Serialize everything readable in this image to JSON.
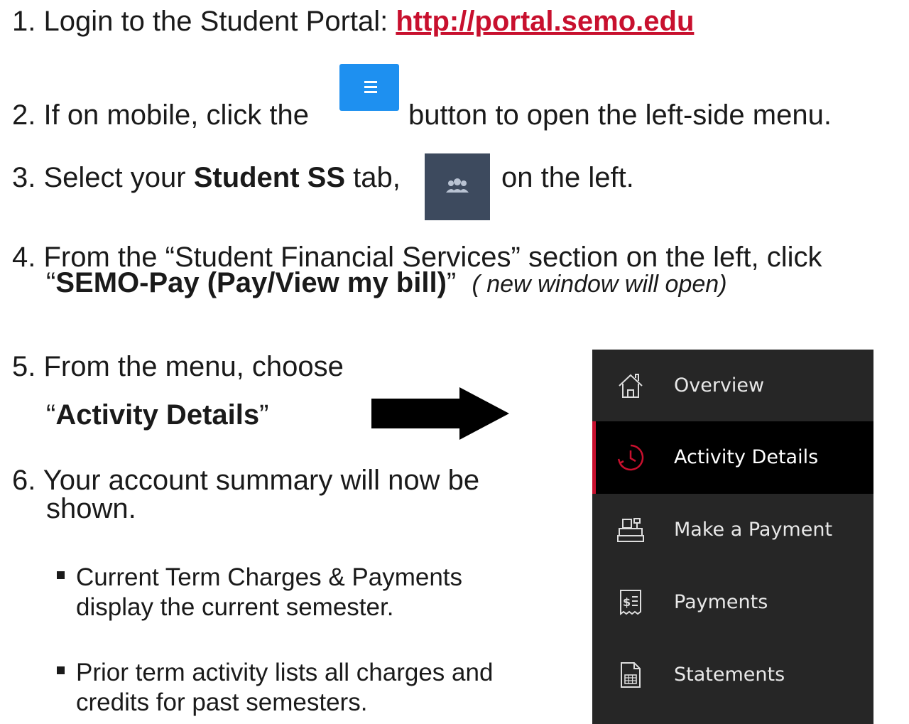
{
  "steps": {
    "s1": {
      "prefix": "1. Login to the Student Portal:  ",
      "link": "http://portal.semo.edu"
    },
    "s2": {
      "before": "2. If on mobile, click the ",
      "after": " button to open the left-side menu."
    },
    "s3": {
      "before": "3. Select your ",
      "bold": "Student SS",
      "mid": " tab, ",
      "after": " on the left."
    },
    "s4": {
      "line1": "4. From the “Student Financial Services” section on the left, click",
      "q_open": "“",
      "bold": "SEMO-Pay (Pay/View my bill)",
      "q_close": "”",
      "note": "( new window will open)"
    },
    "s5": {
      "line1": "5. From the menu, choose",
      "q_open": "“",
      "bold": "Activity Details",
      "q_close": "”"
    },
    "s6": {
      "line1": "6. Your account summary will now be",
      "line2": "shown.",
      "bullets": [
        {
          "line1": "Current Term Charges & Payments",
          "line2": "display the current semester."
        },
        {
          "line1": "Prior term activity lists all charges and",
          "line2": "credits for past semesters."
        }
      ]
    }
  },
  "sidebar": {
    "items": [
      {
        "label": "Overview",
        "icon": "home-icon"
      },
      {
        "label": "Activity Details",
        "icon": "clock-icon",
        "active": true
      },
      {
        "label": "Make a Payment",
        "icon": "cash-register-icon"
      },
      {
        "label": "Payments",
        "icon": "receipt-icon"
      },
      {
        "label": "Statements",
        "icon": "statement-icon"
      }
    ]
  },
  "colors": {
    "link": "#c8102e",
    "menu_button": "#1e90f0",
    "tab_icon_bg": "#3d4a5e",
    "sidebar_bg": "#262626",
    "active_accent": "#c8102e"
  }
}
